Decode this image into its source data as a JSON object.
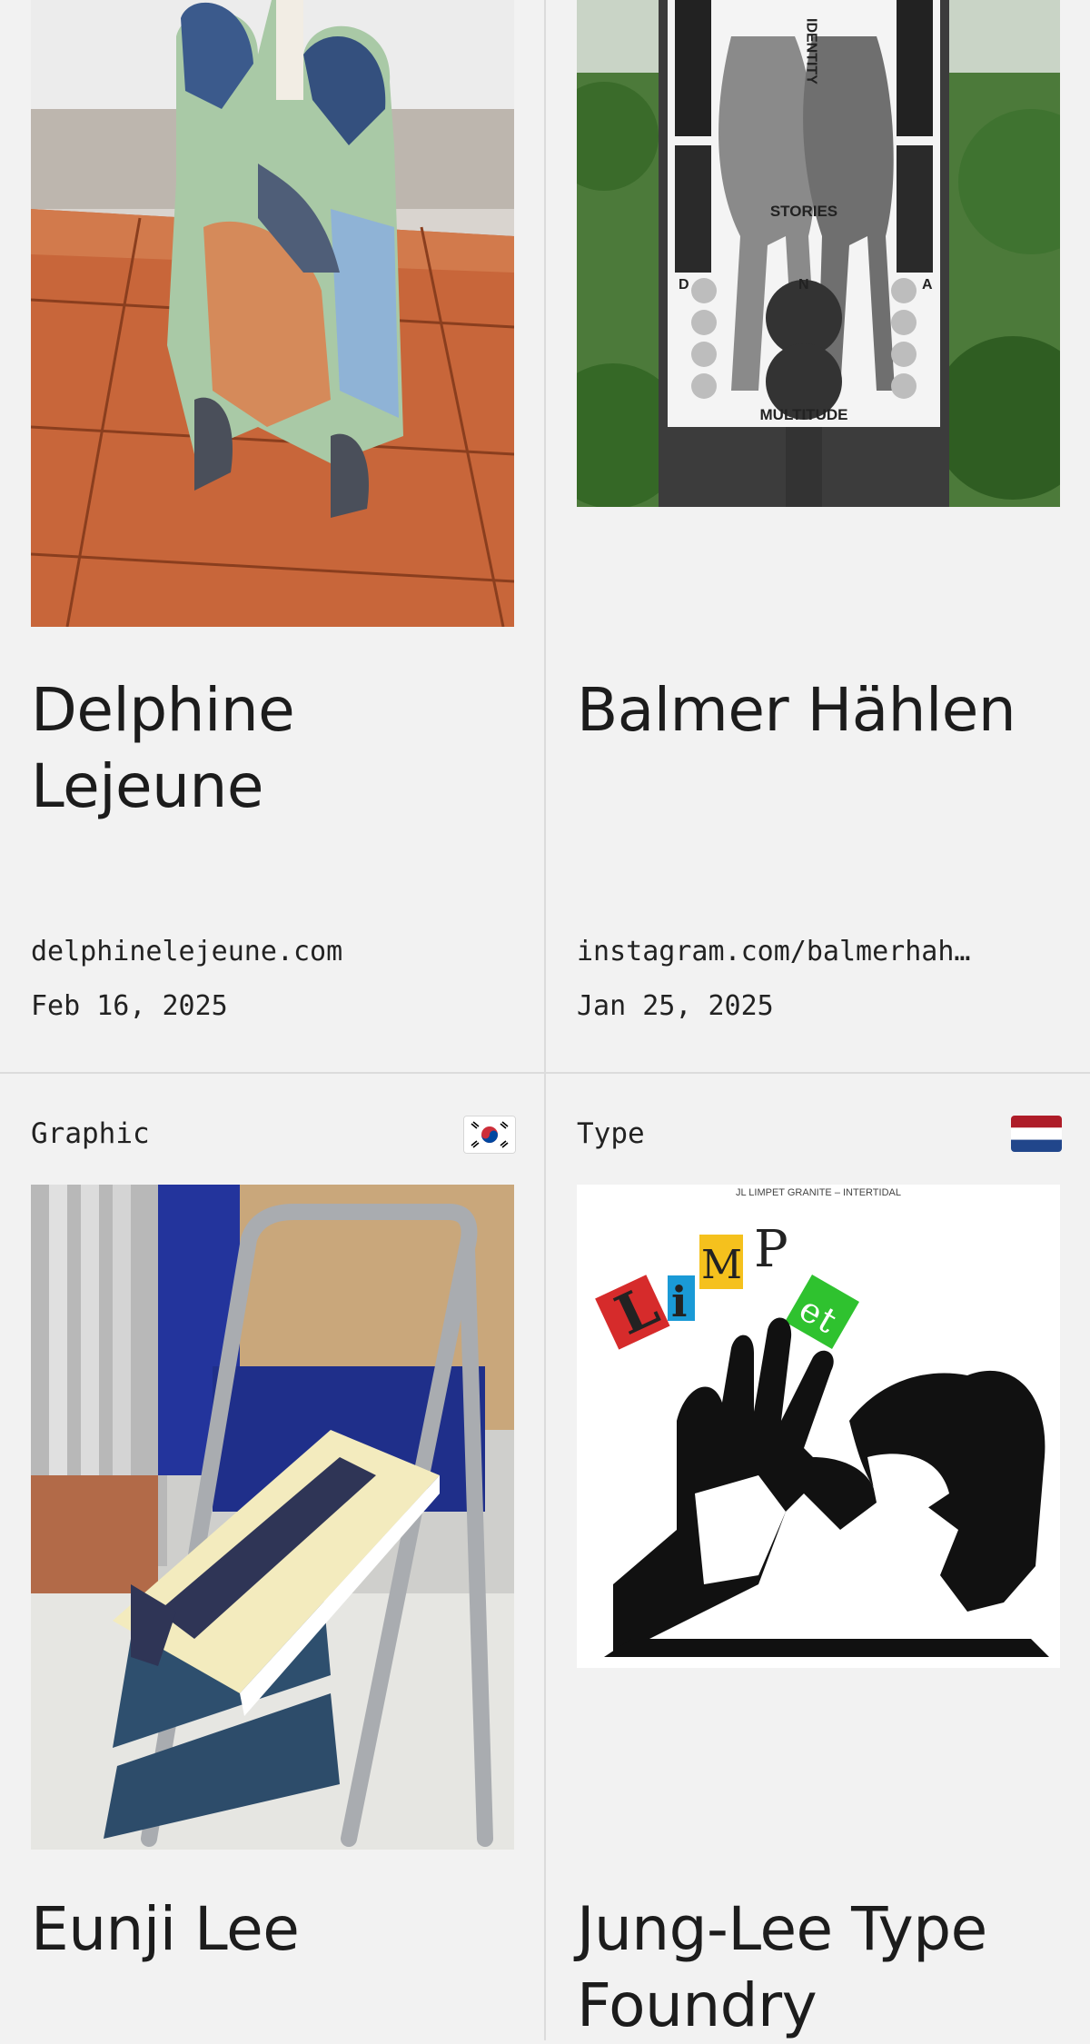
{
  "cards": [
    {
      "category": "",
      "title_line1": "Delphine",
      "title_line2": "Lejeune",
      "link": "delphinelejeune.com",
      "date": "Feb 16, 2025",
      "image_icon": "sculpture-image"
    },
    {
      "category": "",
      "title_line1": "Balmer Hählen",
      "title_line2": "",
      "link": "instagram.com/balmerhah…",
      "date": "Jan 25, 2025",
      "image_icon": "poster-image",
      "poster_words": [
        "IDENTITY",
        "STORIES",
        "MULTITUDE",
        "D",
        "N",
        "A"
      ]
    },
    {
      "category": "Graphic",
      "flag_icon": "south-korea-flag-icon",
      "title_line1": "Eunji Lee",
      "title_line2": "",
      "image_icon": "stepladder-book-image"
    },
    {
      "category": "Type",
      "flag_icon": "netherlands-flag-icon",
      "title_line1": "Jung-Lee Type",
      "title_line2": "Foundry",
      "image_icon": "limpet-type-specimen-image",
      "specimen_caption": "JL LIMPET GRANITE – INTERTIDAL",
      "specimen_letters": [
        "L",
        "i",
        "M",
        "P",
        "e",
        "t"
      ]
    }
  ]
}
